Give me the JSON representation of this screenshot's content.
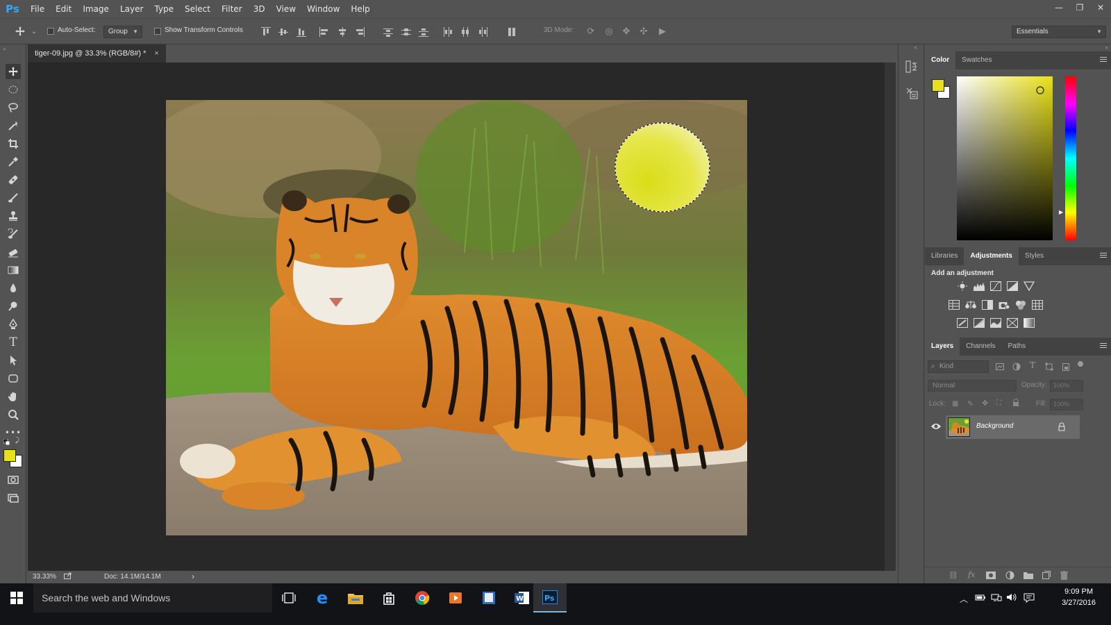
{
  "app": {
    "logo": "Ps"
  },
  "menu": [
    "File",
    "Edit",
    "Image",
    "Layer",
    "Type",
    "Select",
    "Filter",
    "3D",
    "View",
    "Window",
    "Help"
  ],
  "window_controls": {
    "minimize": "—",
    "restore": "❐",
    "close": "✕"
  },
  "options": {
    "auto_select_label": "Auto-Select:",
    "auto_select_value": "Group",
    "transform_label": "Show Transform Controls",
    "mode_3d_label": "3D Mode:",
    "workspace": "Essentials"
  },
  "document": {
    "tab_title": "tiger-09.jpg @ 33.3% (RGB/8#) *",
    "tab_close": "×",
    "zoom": "33.33%",
    "doc_info": "Doc: 14.1M/14.1M",
    "status_arrow": "›"
  },
  "color_panel": {
    "tabs": [
      "Color",
      "Swatches"
    ],
    "foreground": "#e8e01c",
    "background": "#ffffff"
  },
  "adjustments_panel": {
    "tabs": [
      "Libraries",
      "Adjustments",
      "Styles"
    ],
    "heading": "Add an adjustment"
  },
  "layers_panel": {
    "tabs": [
      "Layers",
      "Channels",
      "Paths"
    ],
    "filter_placeholder": "Kind",
    "blend_mode": "Normal",
    "opacity_label": "Opacity:",
    "opacity_value": "100%",
    "lock_label": "Lock:",
    "fill_label": "Fill:",
    "fill_value": "100%",
    "layers": [
      {
        "name": "Background",
        "visible": true,
        "locked": true
      }
    ]
  },
  "taskbar": {
    "search_placeholder": "Search the web and Windows",
    "time": "9:09 PM",
    "date": "3/27/2016"
  }
}
